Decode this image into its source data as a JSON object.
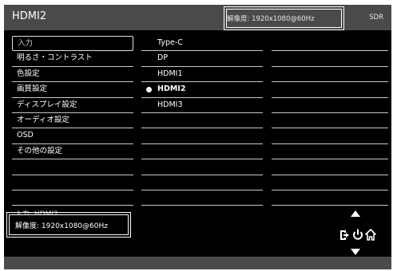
{
  "header": {
    "title": "HDMI2",
    "resolution": "解像度:  1920x1080@60Hz",
    "mode": "SDR"
  },
  "menu": {
    "categories": [
      {
        "label": "入力",
        "selected": true
      },
      {
        "label": "明るさ・コントラスト"
      },
      {
        "label": "色設定"
      },
      {
        "label": "画質設定"
      },
      {
        "label": "ディスプレイ設定"
      },
      {
        "label": "オーディオ設定"
      },
      {
        "label": "OSD"
      },
      {
        "label": "その他の設定"
      },
      {
        "label": ""
      },
      {
        "label": ""
      },
      {
        "label": ""
      }
    ],
    "options": [
      {
        "label": "Type-C"
      },
      {
        "label": "DP"
      },
      {
        "label": "HDMI1"
      },
      {
        "label": "HDMI2",
        "active": true
      },
      {
        "label": "HDMI3"
      },
      {
        "label": ""
      },
      {
        "label": ""
      },
      {
        "label": ""
      },
      {
        "label": ""
      },
      {
        "label": ""
      },
      {
        "label": ""
      }
    ],
    "third_column_rows": 11
  },
  "info": {
    "input": "入力: HDMI2",
    "resolution": "解像度: 1920x1080@60Hz"
  },
  "nav_icons": [
    "up-arrow-icon",
    "exit-icon",
    "power-icon",
    "home-icon",
    "down-arrow-icon"
  ]
}
